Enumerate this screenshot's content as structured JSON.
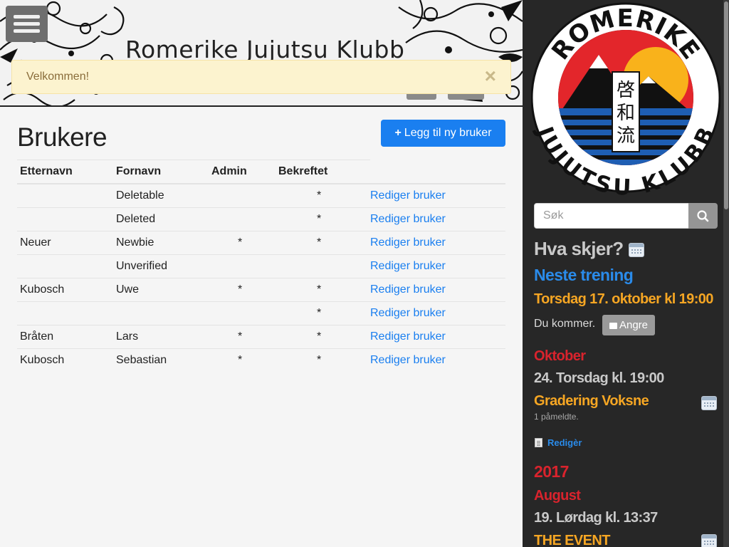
{
  "site": {
    "title": "Romerike Jujutsu Klubb"
  },
  "alert": {
    "message": "Velkommen!",
    "close_label": "×"
  },
  "main": {
    "title": "Brukere",
    "add_button_label": "Legg til ny bruker",
    "add_button_icon": "+",
    "columns": [
      "Etternavn",
      "Fornavn",
      "Admin",
      "Bekreftet"
    ],
    "edit_link_label": "Rediger bruker",
    "rows": [
      {
        "last": "",
        "first": "Deletable",
        "admin": "",
        "confirmed": "*",
        "edit": "Rediger bruker"
      },
      {
        "last": "",
        "first": "Deleted",
        "admin": "",
        "confirmed": "*",
        "edit": "Rediger bruker"
      },
      {
        "last": "Neuer",
        "first": "Newbie",
        "admin": "*",
        "confirmed": "*",
        "edit": "Rediger bruker"
      },
      {
        "last": "",
        "first": "Unverified",
        "admin": "",
        "confirmed": "",
        "edit": "Rediger bruker"
      },
      {
        "last": "Kubosch",
        "first": "Uwe",
        "admin": "*",
        "confirmed": "*",
        "edit": "Rediger bruker"
      },
      {
        "last": "",
        "first": "",
        "admin": "",
        "confirmed": "*",
        "edit": "Rediger bruker"
      },
      {
        "last": "Bråten",
        "first": "Lars",
        "admin": "*",
        "confirmed": "*",
        "edit": "Rediger bruker"
      },
      {
        "last": "Kubosch",
        "first": "Sebastian",
        "admin": "*",
        "confirmed": "*",
        "edit": "Rediger bruker"
      }
    ]
  },
  "sidebar": {
    "logo": {
      "top_text": "ROMERIKE",
      "bottom_text": "JUJUTSU KLUBB",
      "kanji": [
        "啓",
        "和",
        "流"
      ]
    },
    "search": {
      "placeholder": "Søk",
      "value": ""
    },
    "heading": "Hva skjer?",
    "next_training": {
      "label": "Neste trening",
      "when": "Torsdag 17. oktober kl 19:00",
      "status": "Du kommer.",
      "undo_label": "Angre"
    },
    "month_1": "Oktober",
    "event_1": {
      "datetime": "24. Torsdag kl. 19:00",
      "name": "Gradering Voksne",
      "participants": "1 påmeldte.",
      "edit_label": "Redigèr"
    },
    "year": "2017",
    "month_2": "August",
    "event_2": {
      "datetime": "19. Lørdag kl. 13:37",
      "name": "THE EVENT"
    }
  },
  "colors": {
    "accent_blue": "#1a7ff0",
    "sidebar_bg": "#272727",
    "alert_bg": "#fcf3cf",
    "event_orange": "#f6a623",
    "month_red": "#d9232d"
  },
  "icons": {
    "menu": "hamburger-icon",
    "search": "magnifier-icon",
    "calendar": "calendar-icon",
    "undo": "thumbs-down-icon",
    "edit": "document-icon",
    "close": "close-icon"
  }
}
